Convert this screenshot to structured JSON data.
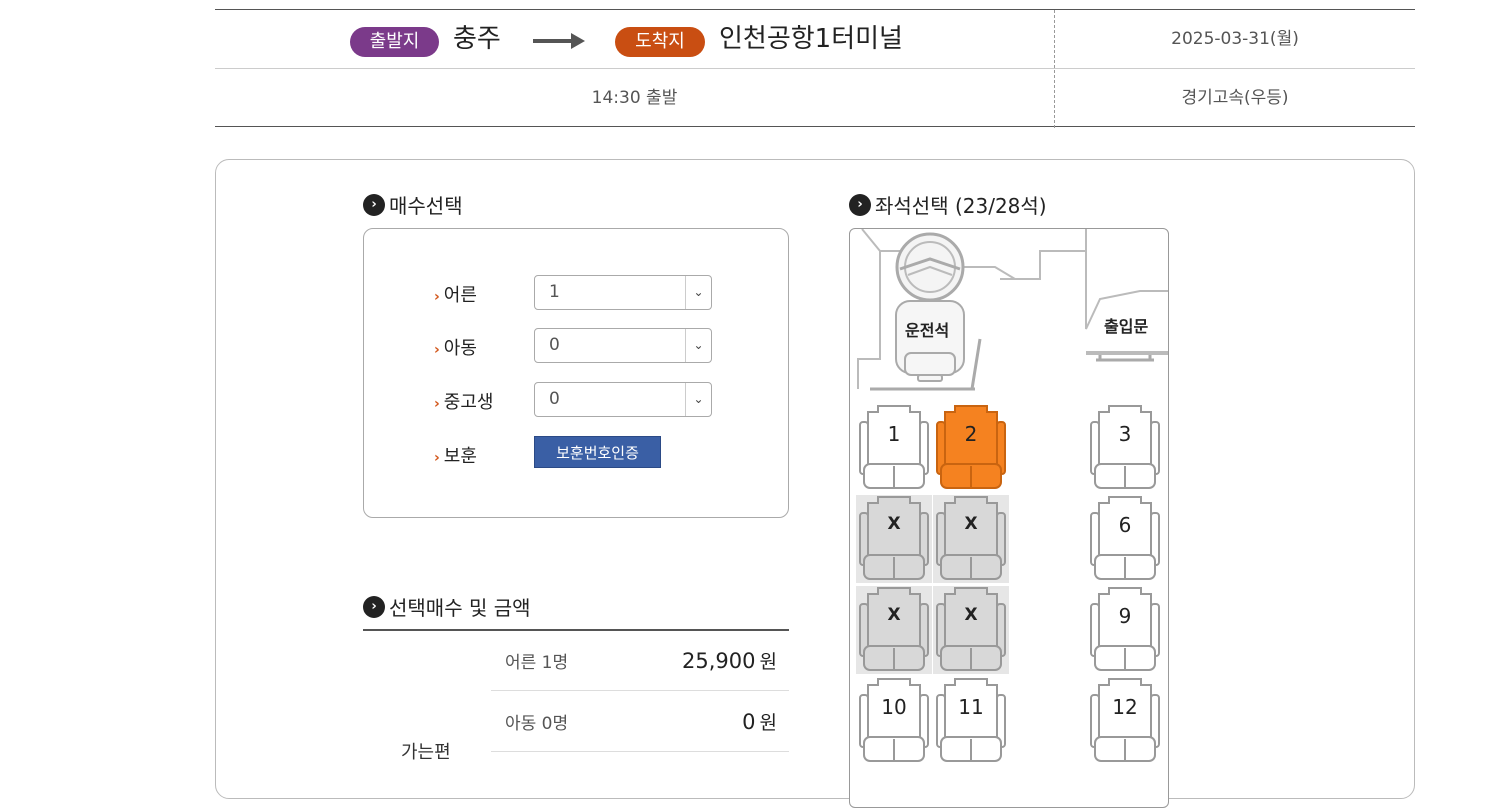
{
  "route": {
    "departure_badge": "출발지",
    "departure_city": "충주",
    "arrival_badge": "도착지",
    "arrival_city": "인천공항1터미널",
    "date": "2025-03-31(월)",
    "departure_time": "14:30 출발",
    "company": "경기고속(우등)",
    "colors": {
      "departure": "#7b3a8a",
      "arrival": "#c94e12"
    }
  },
  "quantity": {
    "title": "매수선택",
    "rows": [
      {
        "label": "어른",
        "value": "1"
      },
      {
        "label": "아동",
        "value": "0"
      },
      {
        "label": "중고생",
        "value": "0"
      }
    ],
    "veteran_label": "보훈",
    "veteran_button": "보훈번호인증"
  },
  "summary": {
    "title": "선택매수 및 금액",
    "trip_label": "가는편",
    "rows": [
      {
        "label": "어른 1명",
        "amount": "25,900",
        "unit": "원"
      },
      {
        "label": "아동 0명",
        "amount": "0",
        "unit": "원"
      }
    ]
  },
  "seats": {
    "title": "좌석선택 (23/28석)",
    "driver_label": "운전석",
    "door_label": "출입문",
    "selected_color": "#f58220",
    "items": [
      {
        "num": "1",
        "state": "available"
      },
      {
        "num": "2",
        "state": "selected"
      },
      {
        "num": "3",
        "state": "available"
      },
      {
        "num": "X",
        "state": "taken"
      },
      {
        "num": "X",
        "state": "taken"
      },
      {
        "num": "6",
        "state": "available"
      },
      {
        "num": "X",
        "state": "taken"
      },
      {
        "num": "X",
        "state": "taken"
      },
      {
        "num": "9",
        "state": "available"
      },
      {
        "num": "10",
        "state": "available"
      },
      {
        "num": "11",
        "state": "available"
      },
      {
        "num": "12",
        "state": "available"
      }
    ]
  }
}
